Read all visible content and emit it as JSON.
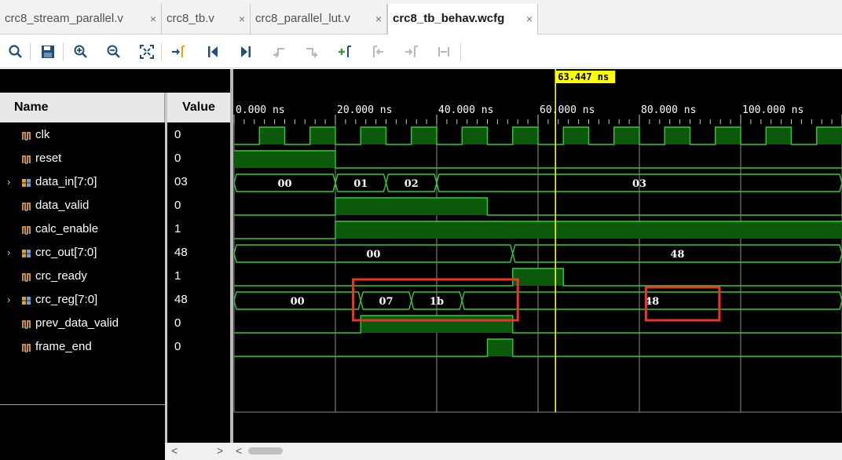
{
  "tabs": [
    {
      "label": "crc8_stream_parallel.v",
      "active": false
    },
    {
      "label": "crc8_tb.v",
      "active": false
    },
    {
      "label": "crc8_parallel_lut.v",
      "active": false
    },
    {
      "label": "crc8_tb_behav.wcfg",
      "active": true
    }
  ],
  "tab_close_glyph": "×",
  "toolbar_icons": [
    "search-icon",
    "save-icon",
    "zoom-in-icon",
    "zoom-out-icon",
    "zoom-fit-icon",
    "goto-cursor-icon",
    "goto-start-icon",
    "goto-end-icon",
    "previous-transition-icon",
    "next-transition-icon",
    "add-marker-icon",
    "previous-marker-icon",
    "next-marker-icon",
    "swap-cursors-icon"
  ],
  "columns": {
    "name": "Name",
    "value": "Value"
  },
  "cursor": {
    "label": "63.447 ns",
    "time_ns": 63.447,
    "color": "#ffff00"
  },
  "time_axis": {
    "ticks": [
      "0.000 ns",
      "20.000 ns",
      "40.000 ns",
      "60.000 ns",
      "80.000 ns",
      "100.000 ns"
    ]
  },
  "signals": [
    {
      "name": "clk",
      "value": "0",
      "bus": false,
      "icon": "signal-bit-icon"
    },
    {
      "name": "reset",
      "value": "0",
      "bus": false,
      "icon": "signal-bit-icon"
    },
    {
      "name": "data_in[7:0]",
      "value": "03",
      "bus": true,
      "icon": "bus-icon"
    },
    {
      "name": "data_valid",
      "value": "0",
      "bus": false,
      "icon": "signal-bit-icon"
    },
    {
      "name": "calc_enable",
      "value": "1",
      "bus": false,
      "icon": "signal-bit-icon"
    },
    {
      "name": "crc_out[7:0]",
      "value": "48",
      "bus": true,
      "icon": "bus-icon"
    },
    {
      "name": "crc_ready",
      "value": "1",
      "bus": false,
      "icon": "signal-bit-icon"
    },
    {
      "name": "crc_reg[7:0]",
      "value": "48",
      "bus": true,
      "icon": "bus-icon"
    },
    {
      "name": "prev_data_valid",
      "value": "0",
      "bus": false,
      "icon": "signal-bit-icon"
    },
    {
      "name": "frame_end",
      "value": "0",
      "bus": false,
      "icon": "signal-bit-icon"
    }
  ],
  "bus_values": {
    "data_in": [
      "00",
      "01",
      "02",
      "03"
    ],
    "crc_out": [
      "00",
      "48"
    ],
    "crc_reg": [
      "00",
      "07",
      "1b",
      "48"
    ]
  },
  "highlight_color": "#e8362d",
  "waveform_color": "#33cc33",
  "scroll": {
    "left": "<",
    "right": ">",
    "left2": "<"
  }
}
